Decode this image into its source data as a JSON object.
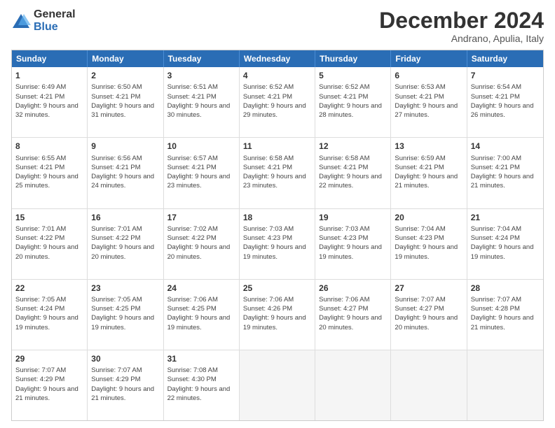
{
  "logo": {
    "general": "General",
    "blue": "Blue"
  },
  "header": {
    "month": "December 2024",
    "location": "Andrano, Apulia, Italy"
  },
  "days": [
    "Sunday",
    "Monday",
    "Tuesday",
    "Wednesday",
    "Thursday",
    "Friday",
    "Saturday"
  ],
  "rows": [
    [
      {
        "day": "1",
        "sunrise": "6:49 AM",
        "sunset": "4:21 PM",
        "daylight": "9 hours and 32 minutes."
      },
      {
        "day": "2",
        "sunrise": "6:50 AM",
        "sunset": "4:21 PM",
        "daylight": "9 hours and 31 minutes."
      },
      {
        "day": "3",
        "sunrise": "6:51 AM",
        "sunset": "4:21 PM",
        "daylight": "9 hours and 30 minutes."
      },
      {
        "day": "4",
        "sunrise": "6:52 AM",
        "sunset": "4:21 PM",
        "daylight": "9 hours and 29 minutes."
      },
      {
        "day": "5",
        "sunrise": "6:52 AM",
        "sunset": "4:21 PM",
        "daylight": "9 hours and 28 minutes."
      },
      {
        "day": "6",
        "sunrise": "6:53 AM",
        "sunset": "4:21 PM",
        "daylight": "9 hours and 27 minutes."
      },
      {
        "day": "7",
        "sunrise": "6:54 AM",
        "sunset": "4:21 PM",
        "daylight": "9 hours and 26 minutes."
      }
    ],
    [
      {
        "day": "8",
        "sunrise": "6:55 AM",
        "sunset": "4:21 PM",
        "daylight": "9 hours and 25 minutes."
      },
      {
        "day": "9",
        "sunrise": "6:56 AM",
        "sunset": "4:21 PM",
        "daylight": "9 hours and 24 minutes."
      },
      {
        "day": "10",
        "sunrise": "6:57 AM",
        "sunset": "4:21 PM",
        "daylight": "9 hours and 23 minutes."
      },
      {
        "day": "11",
        "sunrise": "6:58 AM",
        "sunset": "4:21 PM",
        "daylight": "9 hours and 23 minutes."
      },
      {
        "day": "12",
        "sunrise": "6:58 AM",
        "sunset": "4:21 PM",
        "daylight": "9 hours and 22 minutes."
      },
      {
        "day": "13",
        "sunrise": "6:59 AM",
        "sunset": "4:21 PM",
        "daylight": "9 hours and 21 minutes."
      },
      {
        "day": "14",
        "sunrise": "7:00 AM",
        "sunset": "4:21 PM",
        "daylight": "9 hours and 21 minutes."
      }
    ],
    [
      {
        "day": "15",
        "sunrise": "7:01 AM",
        "sunset": "4:22 PM",
        "daylight": "9 hours and 20 minutes."
      },
      {
        "day": "16",
        "sunrise": "7:01 AM",
        "sunset": "4:22 PM",
        "daylight": "9 hours and 20 minutes."
      },
      {
        "day": "17",
        "sunrise": "7:02 AM",
        "sunset": "4:22 PM",
        "daylight": "9 hours and 20 minutes."
      },
      {
        "day": "18",
        "sunrise": "7:03 AM",
        "sunset": "4:23 PM",
        "daylight": "9 hours and 19 minutes."
      },
      {
        "day": "19",
        "sunrise": "7:03 AM",
        "sunset": "4:23 PM",
        "daylight": "9 hours and 19 minutes."
      },
      {
        "day": "20",
        "sunrise": "7:04 AM",
        "sunset": "4:23 PM",
        "daylight": "9 hours and 19 minutes."
      },
      {
        "day": "21",
        "sunrise": "7:04 AM",
        "sunset": "4:24 PM",
        "daylight": "9 hours and 19 minutes."
      }
    ],
    [
      {
        "day": "22",
        "sunrise": "7:05 AM",
        "sunset": "4:24 PM",
        "daylight": "9 hours and 19 minutes."
      },
      {
        "day": "23",
        "sunrise": "7:05 AM",
        "sunset": "4:25 PM",
        "daylight": "9 hours and 19 minutes."
      },
      {
        "day": "24",
        "sunrise": "7:06 AM",
        "sunset": "4:25 PM",
        "daylight": "9 hours and 19 minutes."
      },
      {
        "day": "25",
        "sunrise": "7:06 AM",
        "sunset": "4:26 PM",
        "daylight": "9 hours and 19 minutes."
      },
      {
        "day": "26",
        "sunrise": "7:06 AM",
        "sunset": "4:27 PM",
        "daylight": "9 hours and 20 minutes."
      },
      {
        "day": "27",
        "sunrise": "7:07 AM",
        "sunset": "4:27 PM",
        "daylight": "9 hours and 20 minutes."
      },
      {
        "day": "28",
        "sunrise": "7:07 AM",
        "sunset": "4:28 PM",
        "daylight": "9 hours and 21 minutes."
      }
    ],
    [
      {
        "day": "29",
        "sunrise": "7:07 AM",
        "sunset": "4:29 PM",
        "daylight": "9 hours and 21 minutes."
      },
      {
        "day": "30",
        "sunrise": "7:07 AM",
        "sunset": "4:29 PM",
        "daylight": "9 hours and 21 minutes."
      },
      {
        "day": "31",
        "sunrise": "7:08 AM",
        "sunset": "4:30 PM",
        "daylight": "9 hours and 22 minutes."
      },
      null,
      null,
      null,
      null
    ]
  ],
  "labels": {
    "sunrise": "Sunrise:",
    "sunset": "Sunset:",
    "daylight": "Daylight:"
  }
}
